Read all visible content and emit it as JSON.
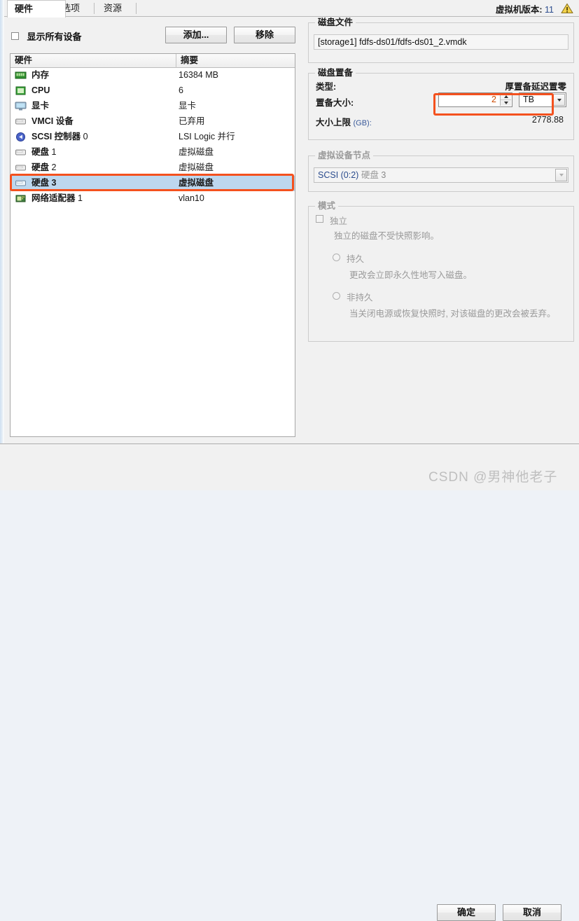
{
  "window": {
    "version_label": "虚拟机版本:",
    "version_value": "11",
    "warning_icon": "warning-triangle-icon"
  },
  "tabs": [
    {
      "label": "硬件",
      "active": true
    },
    {
      "label": "选项",
      "active": false
    },
    {
      "label": "资源",
      "active": false
    }
  ],
  "toolbar": {
    "show_all_devices_label": "显示所有设备",
    "show_all_devices_checked": false,
    "add_label": "添加...",
    "remove_label": "移除"
  },
  "hardware_list": {
    "columns": [
      "硬件",
      "摘要"
    ],
    "rows": [
      {
        "icon": "memory-icon",
        "name": "内存",
        "suffix": "",
        "summary": "16384 MB",
        "selected": false
      },
      {
        "icon": "cpu-icon",
        "name": "CPU",
        "suffix": "",
        "summary": "6",
        "selected": false
      },
      {
        "icon": "display-icon",
        "name": "显卡",
        "suffix": "",
        "summary": "显卡",
        "selected": false
      },
      {
        "icon": "vmci-device-icon",
        "name": "VMCI 设备",
        "suffix": "",
        "summary": "已弃用",
        "selected": false
      },
      {
        "icon": "scsi-controller-icon",
        "name": "SCSI 控制器",
        "suffix": "0",
        "summary": "LSI Logic 并行",
        "selected": false
      },
      {
        "icon": "hard-disk-icon",
        "name": "硬盘",
        "suffix": "1",
        "summary": "虚拟磁盘",
        "selected": false
      },
      {
        "icon": "hard-disk-icon",
        "name": "硬盘",
        "suffix": "2",
        "summary": "虚拟磁盘",
        "selected": false
      },
      {
        "icon": "hard-disk-icon",
        "name": "硬盘",
        "suffix": "3",
        "summary": "虚拟磁盘",
        "selected": true
      },
      {
        "icon": "network-adapter-icon",
        "name": "网络适配器",
        "suffix": "1",
        "summary": "vlan10",
        "selected": false
      }
    ]
  },
  "disk_file": {
    "group_title": "磁盘文件",
    "path": "[storage1] fdfs-ds01/fdfs-ds01_2.vmdk"
  },
  "disk_provisioning": {
    "group_title": "磁盘置备",
    "type_label": "类型:",
    "type_value": "厚置备延迟置零",
    "size_label": "置备大小:",
    "size_value": "2",
    "size_unit": "TB",
    "max_size_label": "大小上限",
    "max_size_unit": "(GB):",
    "max_size_value": "2778.88"
  },
  "virtual_device_node": {
    "group_title": "虚拟设备节点",
    "value_primary": "SCSI (0:2)",
    "value_secondary": "硬盘",
    "value_index": "3"
  },
  "mode": {
    "group_title": "模式",
    "independent_label": "独立",
    "independent_checked": false,
    "independent_desc": "独立的磁盘不受快照影响。",
    "persistent_label": "持久",
    "persistent_desc": "更改会立即永久性地写入磁盘。",
    "nonpersistent_label": "非持久",
    "nonpersistent_desc": "当关闭电源或恢复快照时, 对该磁盘的更改会被丢弃。"
  },
  "footer": {
    "ok_label": "确定",
    "cancel_label": "取消",
    "watermark": "CSDN @男神他老子"
  },
  "colors": {
    "accent_annotation": "#f4511e",
    "selection": "#bdd7ee",
    "spinner_value": "#cc4a00",
    "disabled_text": "#9a9a9a"
  }
}
